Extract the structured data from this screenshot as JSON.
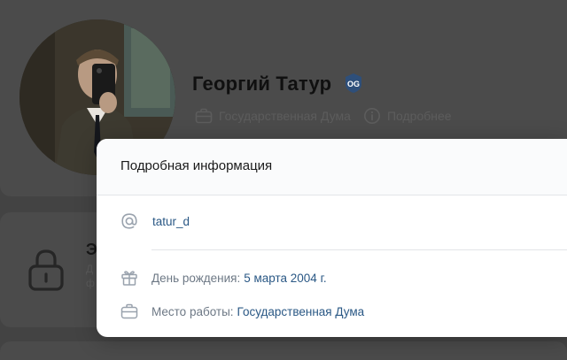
{
  "profile": {
    "name": "Георгий Татур",
    "work": "Государственная Дума",
    "more_link": "Подробнее"
  },
  "lock_card": {
    "title_fragment": "Э",
    "subtitle_line1": "Д",
    "subtitle_line2": "ф"
  },
  "modal": {
    "title": "Подробная информация",
    "username": "tatur_d",
    "birthday_label": "День рождения:",
    "birthday_value": "5 марта 2004 г.",
    "work_label": "Место работы:",
    "work_value": "Государственная Дума"
  },
  "colors": {
    "link": "#2a5885",
    "label": "#6d7885",
    "icon": "#99a2ad",
    "overlay": "#434343"
  },
  "icons": {
    "username": "at-icon",
    "birthday": "gift-icon",
    "work": "briefcase-icon",
    "more": "info-circle-icon",
    "badge": "verified-badge-icon",
    "lock": "lock-icon"
  }
}
